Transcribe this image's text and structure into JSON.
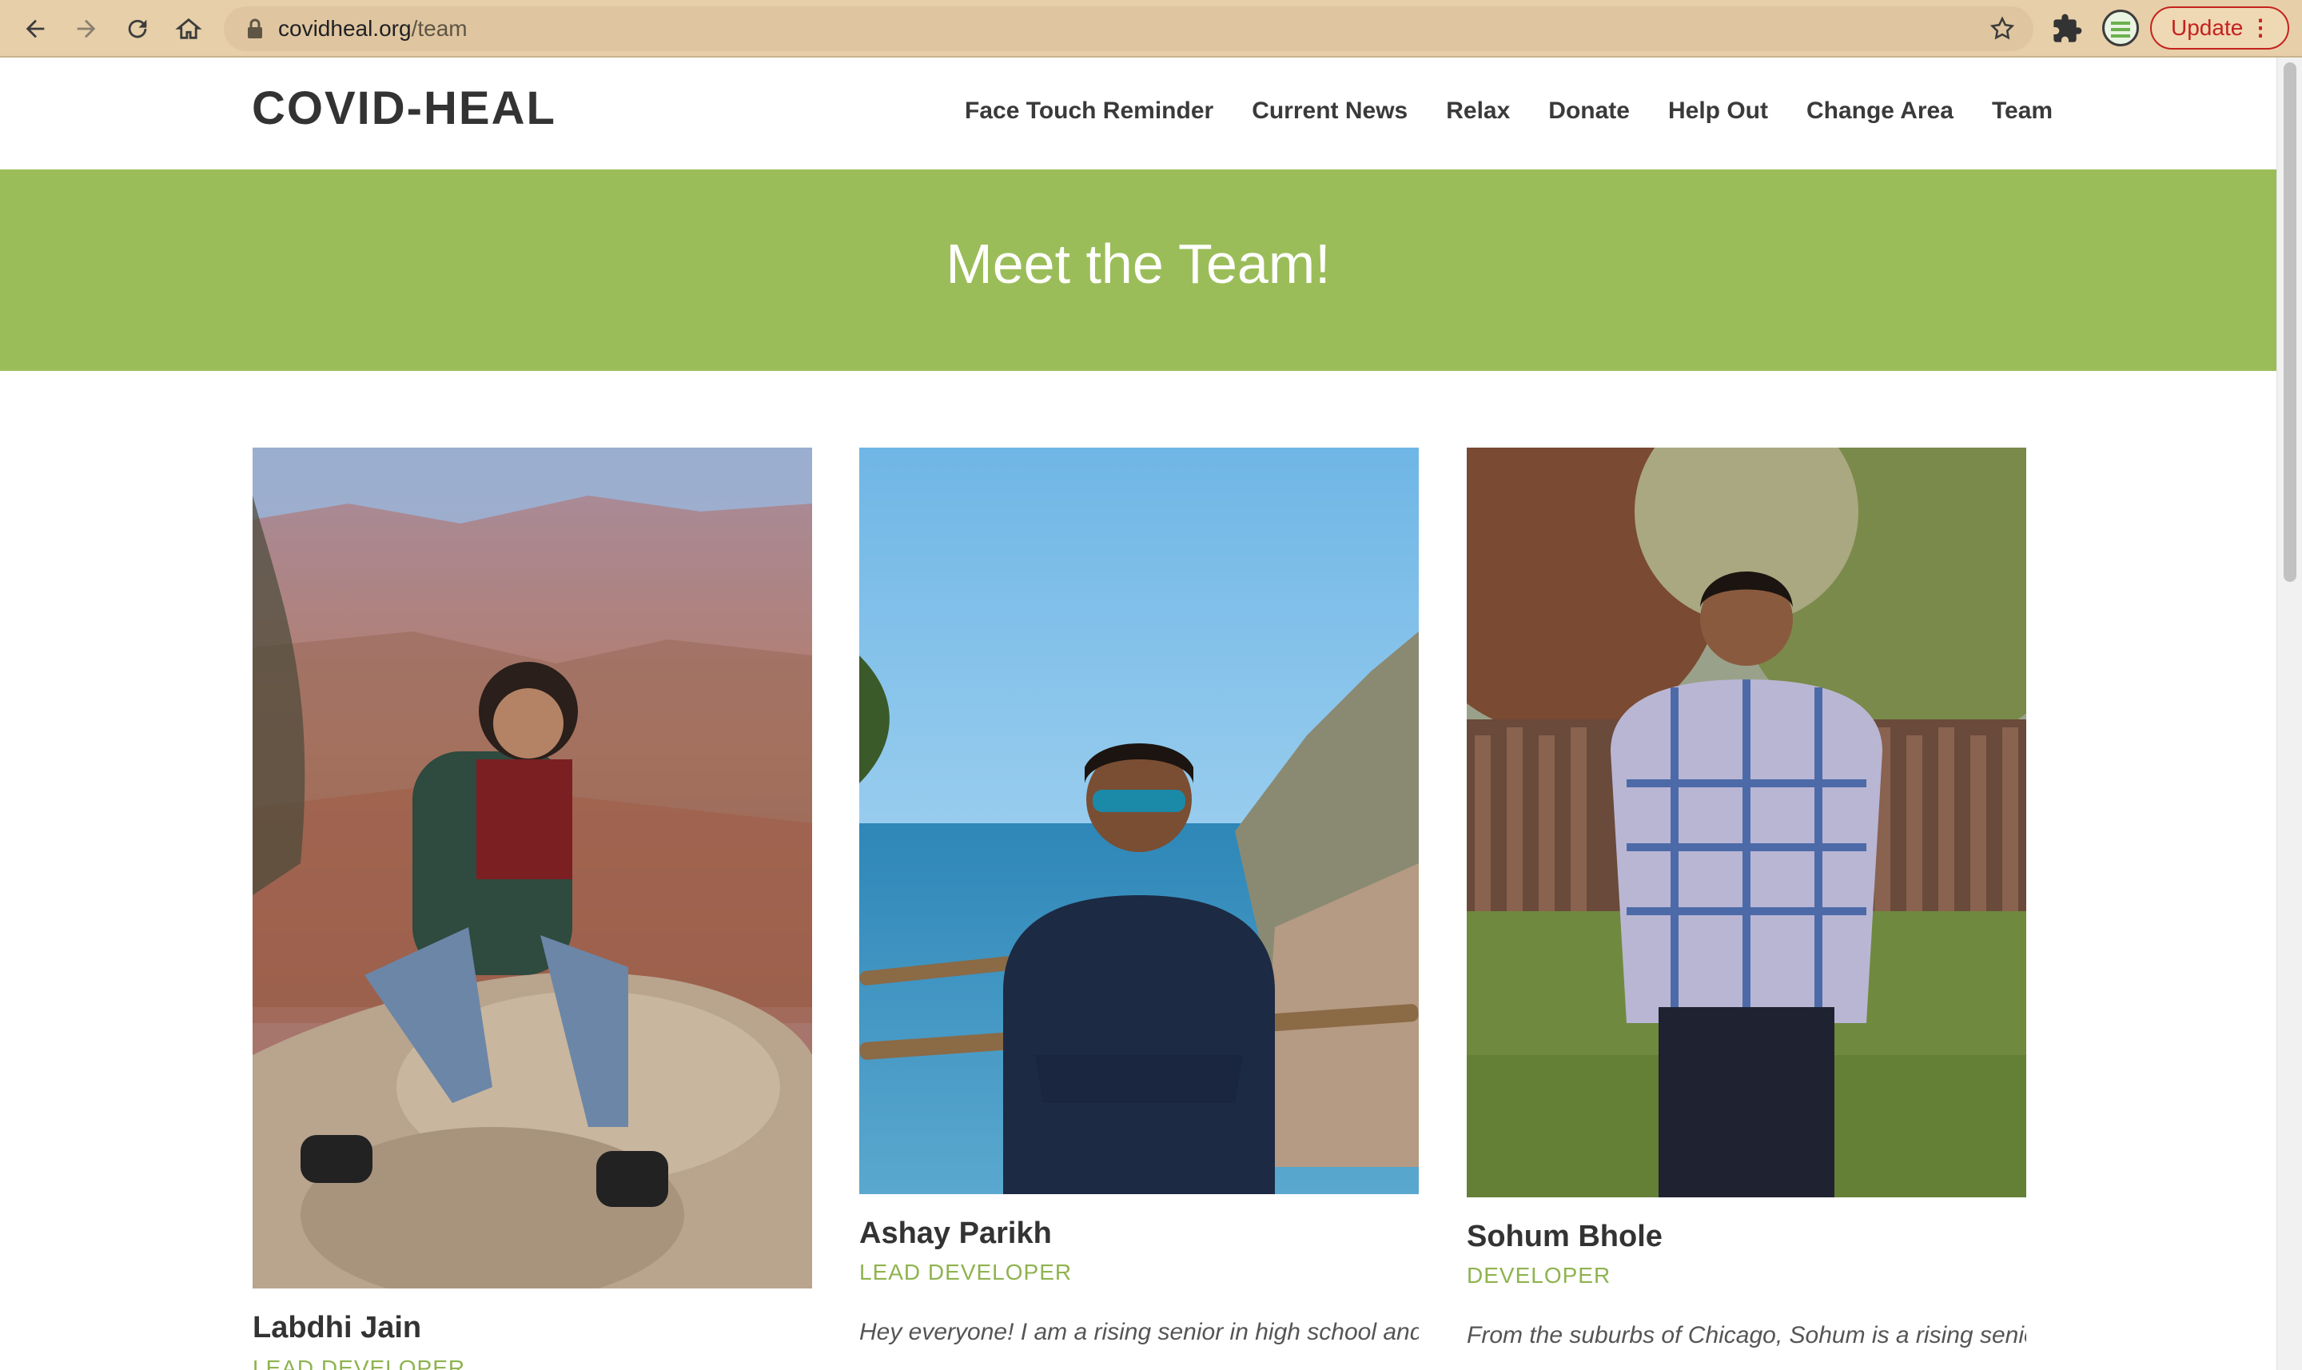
{
  "browser": {
    "url_domain": "covidheal.org",
    "url_path": "/team",
    "update_label": "Update",
    "update_menu": "⋮"
  },
  "site": {
    "logo": "COVID-HEAL",
    "nav": [
      {
        "label": "Face Touch Reminder"
      },
      {
        "label": "Current News"
      },
      {
        "label": "Relax"
      },
      {
        "label": "Donate"
      },
      {
        "label": "Help Out"
      },
      {
        "label": "Change Area"
      },
      {
        "label": "Team"
      }
    ]
  },
  "hero": {
    "title": "Meet the Team!"
  },
  "team": [
    {
      "name": "Labdhi Jain",
      "role": "LEAD DEVELOPER",
      "bio": ""
    },
    {
      "name": "Ashay Parikh",
      "role": "LEAD DEVELOPER",
      "bio": "Hey everyone! I am a rising senior in high school and an"
    },
    {
      "name": "Sohum Bhole",
      "role": "DEVELOPER",
      "bio": "From the suburbs of Chicago, Sohum is a rising senior"
    }
  ],
  "colors": {
    "accent_green": "#9bbd59",
    "role_green": "#8fb34f"
  }
}
